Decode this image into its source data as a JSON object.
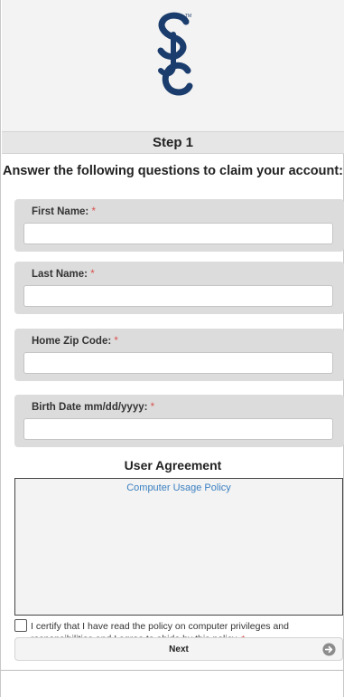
{
  "header": {
    "logo_icon": "sjc-monogram-logo",
    "logo_color": "#1b3d6d"
  },
  "step": {
    "title": "Step 1"
  },
  "instructions": "Answer the following questions to claim your account:",
  "required_marker": "*",
  "fields": [
    {
      "label": "First Name:",
      "value": ""
    },
    {
      "label": "Last Name:",
      "value": ""
    },
    {
      "label": "Home Zip Code:",
      "value": ""
    },
    {
      "label": "Birth Date mm/dd/yyyy:",
      "value": ""
    }
  ],
  "agreement": {
    "title": "User Agreement",
    "policy_link": "Computer Usage Policy",
    "certify_text": "I certify that I have read the policy on computer privileges and responsibilities and I agree to abide by this policy.",
    "certify_checked": false
  },
  "next_button": {
    "label": "Next",
    "icon": "arrow-right-circle-icon"
  },
  "colors": {
    "accent_blue": "#3a7fc1",
    "required_red": "#d9534f",
    "card_gray": "#dcdcdc"
  }
}
